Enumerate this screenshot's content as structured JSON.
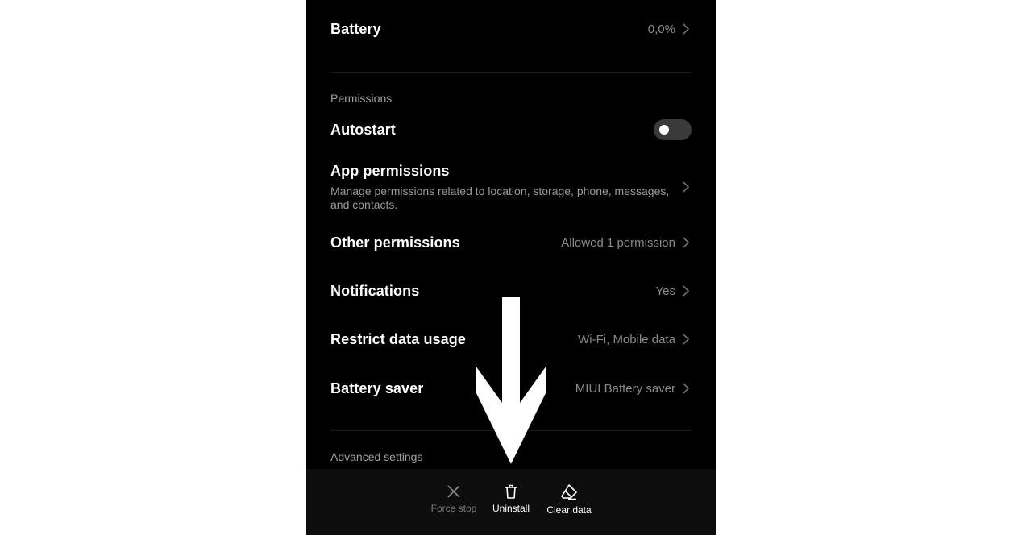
{
  "rows": {
    "battery": {
      "title": "Battery",
      "value": "0,0%"
    },
    "autostart": {
      "title": "Autostart",
      "enabled": false
    },
    "app_permissions": {
      "title": "App permissions",
      "description": "Manage permissions related to location, storage, phone, messages, and contacts."
    },
    "other_permissions": {
      "title": "Other permissions",
      "value": "Allowed 1 permission"
    },
    "notifications": {
      "title": "Notifications",
      "value": "Yes"
    },
    "restrict_data": {
      "title": "Restrict data usage",
      "value": "Wi-Fi, Mobile data"
    },
    "battery_saver": {
      "title": "Battery saver",
      "value": "MIUI Battery saver"
    }
  },
  "sections": {
    "permissions": "Permissions",
    "advanced": "Advanced settings"
  },
  "bottom_actions": {
    "force_stop": {
      "label": "Force stop",
      "icon": "close-icon",
      "enabled": false
    },
    "uninstall": {
      "label": "Uninstall",
      "icon": "trash-icon",
      "enabled": true
    },
    "clear_data": {
      "label": "Clear data",
      "icon": "eraser-icon",
      "enabled": true
    }
  },
  "colors": {
    "background": "#000000",
    "text_primary": "#ffffff",
    "text_secondary": "#8a8a8a",
    "disabled": "#7a7a7a",
    "bottom_bar": "#0d0d0d"
  }
}
